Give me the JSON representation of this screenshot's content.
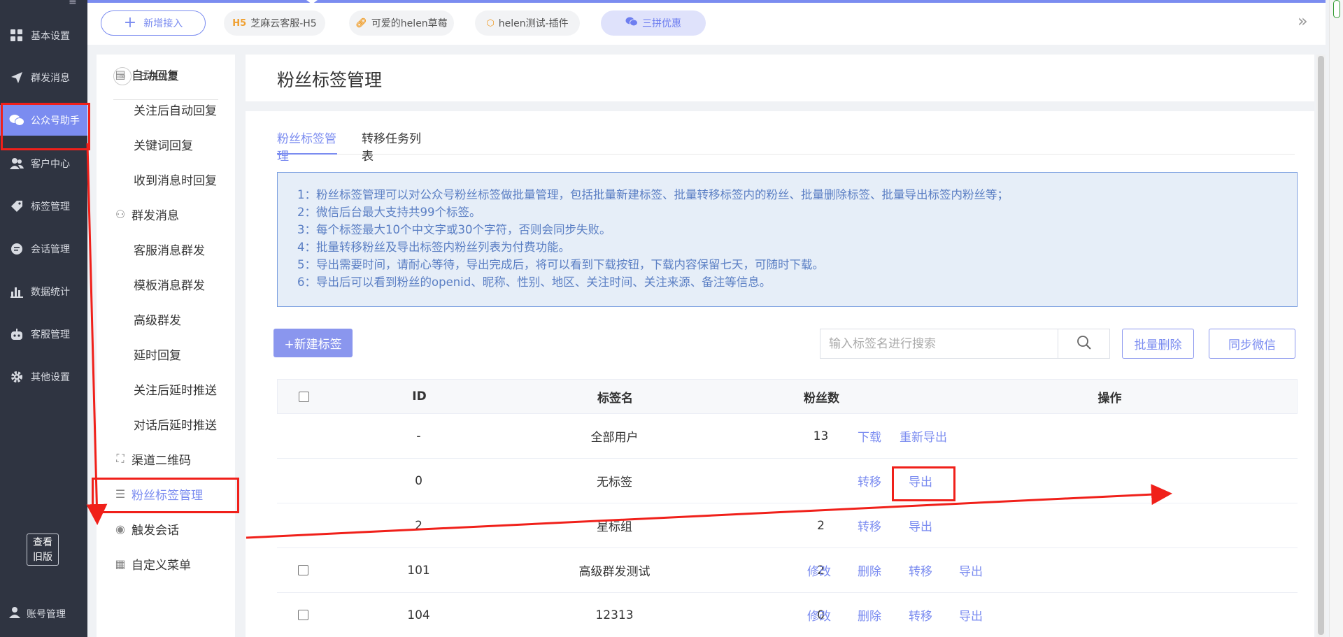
{
  "nav": {
    "items": [
      {
        "label": "基本设置",
        "icon": "grid-icon"
      },
      {
        "label": "群发消息",
        "icon": "paper-plane-icon"
      },
      {
        "label": "公众号助手",
        "icon": "wechat-icon"
      },
      {
        "label": "客户中心",
        "icon": "users-icon"
      },
      {
        "label": "标签管理",
        "icon": "tag-icon"
      },
      {
        "label": "会话管理",
        "icon": "chat-icon"
      },
      {
        "label": "数据统计",
        "icon": "bar-chart-icon"
      },
      {
        "label": "客服管理",
        "icon": "robot-icon"
      },
      {
        "label": "其他设置",
        "icon": "gear-icon"
      }
    ],
    "old_version_line1": "查看",
    "old_version_line2": "旧版",
    "account": "账号管理"
  },
  "topbar": {
    "add_label": "新增接入",
    "chips": [
      {
        "label": "芝麻云客服-H5",
        "badge": "H5"
      },
      {
        "label": "可爱的helen草莓",
        "badge": "link-icon"
      },
      {
        "label": "helen测试-插件",
        "badge": "cube-icon"
      },
      {
        "label": "三拼优惠",
        "badge": "wechat-icon"
      }
    ],
    "expand_icon": "»"
  },
  "subnav": {
    "title": "三拼优惠",
    "items": [
      {
        "label": "自动回复",
        "type": "group",
        "icon": "message-icon"
      },
      {
        "label": "关注后自动回复",
        "type": "leaf"
      },
      {
        "label": "关键词回复",
        "type": "leaf"
      },
      {
        "label": "收到消息时回复",
        "type": "leaf"
      },
      {
        "label": "群发消息",
        "type": "group",
        "icon": "users-icon"
      },
      {
        "label": "客服消息群发",
        "type": "leaf"
      },
      {
        "label": "模板消息群发",
        "type": "leaf"
      },
      {
        "label": "高级群发",
        "type": "leaf"
      },
      {
        "label": "延时回复",
        "type": "leaf"
      },
      {
        "label": "关注后延时推送",
        "type": "leaf"
      },
      {
        "label": "对话后延时推送",
        "type": "leaf"
      },
      {
        "label": "渠道二维码",
        "type": "group",
        "icon": "scan-icon"
      },
      {
        "label": "粉丝标签管理",
        "type": "group",
        "icon": "tag-list-icon"
      },
      {
        "label": "触发会话",
        "type": "group",
        "icon": "signal-icon"
      },
      {
        "label": "自定义菜单",
        "type": "group",
        "icon": "menu-grid-icon"
      }
    ]
  },
  "page": {
    "title": "粉丝标签管理",
    "tabs": [
      "粉丝标签管理",
      "转移任务列表"
    ],
    "notice": [
      "1：粉丝标签管理可以对公众号粉丝标签做批量管理，包括批量新建标签、批量转移标签内的粉丝、批量删除标签、批量导出标签内粉丝等；",
      "2：微信后台最大支持共99个标签。",
      "3：每个标签最大10个中文字或30个字符，否则会同步失败。",
      "4：批量转移粉丝及导出标签内粉丝列表为付费功能。",
      "5：导出需要时间，请耐心等待，导出完成后，将可以看到下载按钮，下载内容保留七天，可随时下载。",
      "6：导出后可以看到粉丝的openid、昵称、性别、地区、关注时间、关注来源、备注等信息。"
    ],
    "new_tag": "+新建标签",
    "search_placeholder": "输入标签名进行搜索",
    "batch_delete": "批量删除",
    "sync_wechat": "同步微信"
  },
  "table": {
    "headers": [
      "ID",
      "标签名",
      "粉丝数",
      "操作"
    ],
    "rows": [
      {
        "checkbox": false,
        "id": "-",
        "name": "全部用户",
        "fans": "13",
        "actions": [
          "下载",
          "重新导出"
        ]
      },
      {
        "checkbox": false,
        "id": "0",
        "name": "无标签",
        "fans": "",
        "actions": [
          "转移",
          "导出"
        ]
      },
      {
        "checkbox": false,
        "id": "2",
        "name": "星标组",
        "fans": "2",
        "actions": [
          "转移",
          "导出"
        ]
      },
      {
        "checkbox": true,
        "id": "101",
        "name": "高级群发测试",
        "fans": "2",
        "actions": [
          "修改",
          "删除",
          "转移",
          "导出"
        ]
      },
      {
        "checkbox": true,
        "id": "104",
        "name": "12313",
        "fans": "0",
        "actions": [
          "修改",
          "删除",
          "转移",
          "导出"
        ]
      }
    ]
  },
  "colors": {
    "accent": "#7b8cf0",
    "nav_bg": "#2f3441",
    "annotation": "#f0201a",
    "notice_bg": "#e6eef8",
    "notice_text": "#5b7fc4"
  }
}
